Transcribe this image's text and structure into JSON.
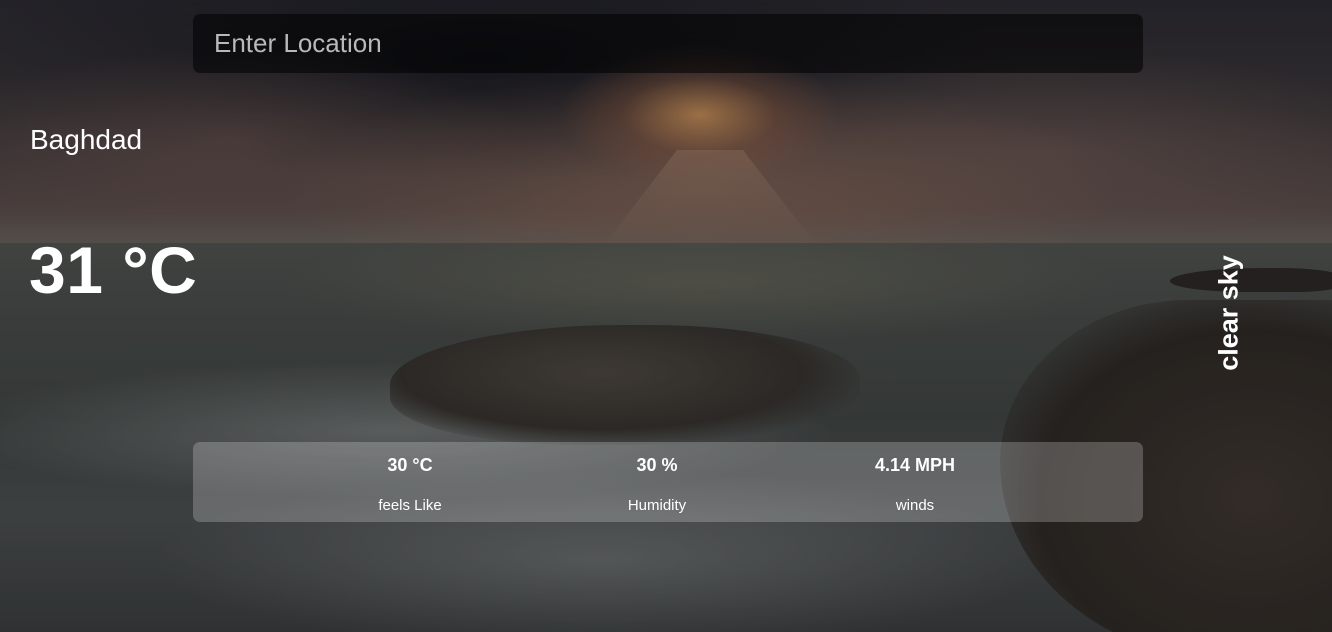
{
  "search": {
    "placeholder": "Enter Location",
    "value": ""
  },
  "weather": {
    "location": "Baghdad",
    "temperature": "31 °C",
    "description": "clear sky"
  },
  "stats": {
    "feels_like": {
      "value": "30 °C",
      "label": "feels Like"
    },
    "humidity": {
      "value": "30 %",
      "label": "Humidity"
    },
    "winds": {
      "value": "4.14 MPH",
      "label": "winds"
    }
  }
}
